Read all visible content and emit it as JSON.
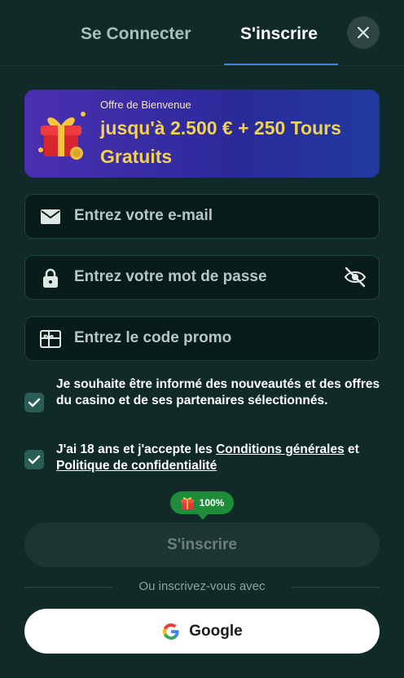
{
  "tabs": {
    "login": "Se Connecter",
    "signup": "S'inscrire"
  },
  "banner": {
    "subtitle": "Offre de Bienvenue",
    "headline": "jusqu'à 2.500 € + 250 Tours Gratuits"
  },
  "form": {
    "email_placeholder": "Entrez votre e-mail",
    "password_placeholder": "Entrez votre mot de passe",
    "promo_placeholder": "Entrez le code promo"
  },
  "consent": {
    "newsletter_text": "Je souhaite être informé des nouveautés et des offres du casino et de ses partenaires sélectionnés.",
    "age_prefix": "J'ai 18 ans et j'accepte les ",
    "terms_link": "Conditions générales",
    "age_middle": " et ",
    "privacy_link": "Politique de confidentialité"
  },
  "progress": {
    "label": "100%",
    "value": 1.0
  },
  "submit_label": "S'inscrire",
  "divider_text": "Ou inscrivez-vous avec",
  "google_label": "Google",
  "colors": {
    "background": "#0f2a27",
    "accent_blue": "#3f82ff",
    "banner_gold": "#f3d24d",
    "checkbox": "#2b5d57",
    "progress_green": "#1d8d3a"
  }
}
